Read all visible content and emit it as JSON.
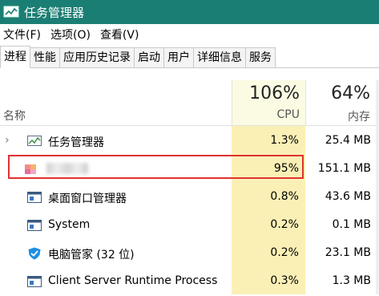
{
  "window": {
    "title": "任务管理器"
  },
  "menu": [
    "文件(F)",
    "选项(O)",
    "查看(V)"
  ],
  "tabs": [
    "进程",
    "性能",
    "应用历史记录",
    "启动",
    "用户",
    "详细信息",
    "服务"
  ],
  "active_tab": "进程",
  "columns": {
    "name": "名称",
    "cpu": {
      "percent": "106%",
      "label": "CPU"
    },
    "memory": {
      "percent": "64%",
      "label": "内存"
    }
  },
  "processes": [
    {
      "name": "任务管理器",
      "cpu": "1.3%",
      "memory": "25.4 MB",
      "icon": "task-manager-icon",
      "expandable": true
    },
    {
      "name": "",
      "cpu": "95%",
      "memory": "151.1 MB",
      "icon": "blurred-app-icon",
      "highlighted": true,
      "name_obscured": true
    },
    {
      "name": "桌面窗口管理器",
      "cpu": "0.8%",
      "memory": "43.6 MB",
      "icon": "window-app-icon"
    },
    {
      "name": "System",
      "cpu": "0.2%",
      "memory": "0.1 MB",
      "icon": "window-app-icon"
    },
    {
      "name": "电脑管家 (32 位)",
      "cpu": "0.2%",
      "memory": "23.1 MB",
      "icon": "shield-icon"
    },
    {
      "name": "Client Server Runtime Process",
      "cpu": "0.3%",
      "memory": "1.3 MB",
      "icon": "window-app-icon"
    }
  ],
  "colors": {
    "titlebar": "#1b7e74",
    "cpu_column": "#faf0b6",
    "highlight": "#e0322f"
  }
}
